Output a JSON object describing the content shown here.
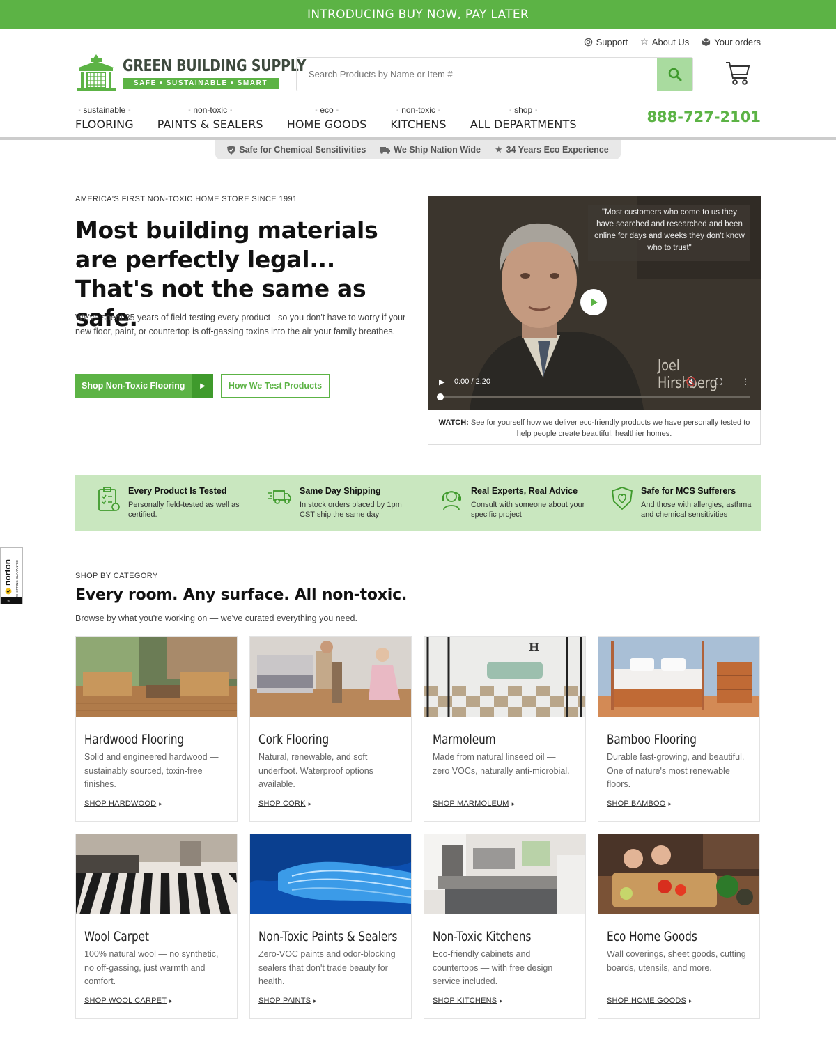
{
  "promo": {
    "text": "INTRODUCING BUY NOW, PAY LATER"
  },
  "utility": [
    {
      "label": "Support",
      "icon": "support-icon"
    },
    {
      "label": "About Us",
      "icon": "star-outline-icon"
    },
    {
      "label": "Your orders",
      "icon": "box-icon"
    }
  ],
  "logo": {
    "name": "GREEN BUILDING SUPPLY",
    "tagline": "SAFE • SUSTAINABLE • SMART"
  },
  "search": {
    "placeholder": "Search Products by Name or Item #"
  },
  "nav": [
    {
      "small": "sustainable",
      "big": "FLOORING"
    },
    {
      "small": "non-toxic",
      "big": "PAINTS & SEALERS"
    },
    {
      "small": "eco",
      "big": "HOME GOODS"
    },
    {
      "small": "non-toxic",
      "big": "KITCHENS"
    },
    {
      "small": "shop",
      "big": "ALL DEPARTMENTS"
    }
  ],
  "phone": "888-727-2101",
  "trust": [
    {
      "label": "Safe for Chemical Sensitivities",
      "icon": "shield-icon"
    },
    {
      "label": "We Ship Nation Wide",
      "icon": "truck-icon"
    },
    {
      "label": "34 Years Eco Experience",
      "icon": "star-icon"
    }
  ],
  "hero": {
    "eyebrow": "AMERICA'S FIRST NON-TOXIC HOME STORE SINCE 1991",
    "title": "Most building materials are perfectly legal... That's not the same as safe.",
    "text": "We've spent 35 years of field-testing every product - so you don't have to worry if your new floor, paint, or countertop is off-gassing toxins into the air your family breathes.",
    "primary_button": "Shop Non-Toxic Flooring",
    "secondary_button": "How We Test Products"
  },
  "video": {
    "quote": "\"Most customers who come to us they have searched and researched and been online for days and weeks they don't know who to trust\"",
    "overlay_name": "Joel Hirshberg",
    "time": "0:00 / 2:20",
    "progress": 0,
    "caption_label": "WATCH:",
    "caption": "See for yourself how we deliver eco-friendly products we have personally tested to help people create beautiful, healthier homes."
  },
  "features": [
    {
      "title": "Every Product Is Tested",
      "desc": "Personally field-tested as well as certified.",
      "icon": "clipboard-icon"
    },
    {
      "title": "Same Day Shipping",
      "desc": "In stock orders placed by 1pm CST ship the same day",
      "icon": "fast-truck-icon"
    },
    {
      "title": "Real Experts, Real Advice",
      "desc": "Consult with someone about your specific project",
      "icon": "headset-icon"
    },
    {
      "title": "Safe for MCS Sufferers",
      "desc": "And those with allergies, asthma and chemical sensitivities",
      "icon": "shield-heart-icon"
    }
  ],
  "norton": {
    "brand": "norton",
    "sub": "SHOPPING GUARANTEE"
  },
  "category": {
    "eyebrow": "SHOP BY CATEGORY",
    "title": "Every room. Any surface. All non-toxic.",
    "subtitle": "Browse by what you're working on — we've curated everything you need.",
    "cards": [
      {
        "title": "Hardwood Flooring",
        "desc": "Solid and engineered hardwood — sustainably sourced, toxin-free finishes.",
        "link": "SHOP HARDWOOD"
      },
      {
        "title": "Cork Flooring",
        "desc": "Natural, renewable, and soft underfoot. Waterproof options available.",
        "link": "SHOP CORK"
      },
      {
        "title": "Marmoleum",
        "desc": "Made from natural linseed oil — zero VOCs, naturally anti-microbial.",
        "link": "SHOP MARMOLEUM"
      },
      {
        "title": "Bamboo Flooring",
        "desc": "Durable fast-growing, and beautiful. One of nature's most renewable floors.",
        "link": "SHOP BAMBOO"
      },
      {
        "title": "Wool Carpet",
        "desc": "100% natural wool — no synthetic, no off-gassing, just warmth and comfort.",
        "link": "SHOP WOOL CARPET"
      },
      {
        "title": "Non-Toxic Paints & Sealers",
        "desc": "Zero-VOC paints and odor-blocking sealers that don't trade beauty for health.",
        "link": "SHOP PAINTS"
      },
      {
        "title": "Non-Toxic Kitchens",
        "desc": "Eco-friendly cabinets and countertops — with free design service included.",
        "link": "SHOP KITCHENS"
      },
      {
        "title": "Eco Home Goods",
        "desc": "Wall coverings, sheet goods, cutting boards, utensils, and more.",
        "link": "SHOP HOME GOODS"
      }
    ]
  },
  "colors": {
    "brand_green": "#5cb345",
    "light_green": "#c9e7bf"
  }
}
